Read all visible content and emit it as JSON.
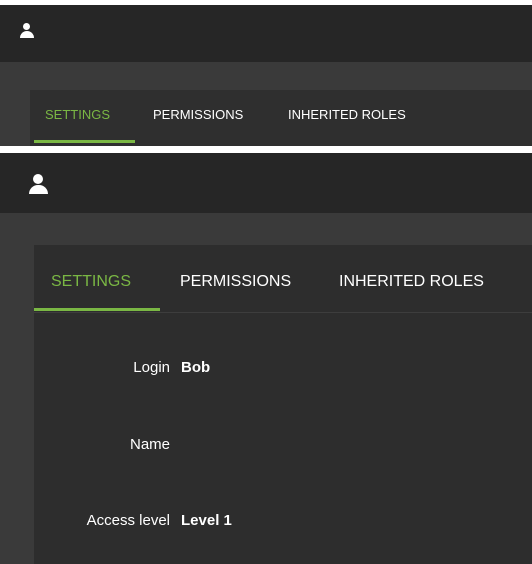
{
  "panel_small": {
    "tabs": [
      {
        "label": "SETTINGS",
        "active": true
      },
      {
        "label": "PERMISSIONS",
        "active": false
      },
      {
        "label": "INHERITED ROLES",
        "active": false
      }
    ]
  },
  "panel_large": {
    "tabs": [
      {
        "label": "SETTINGS",
        "active": true
      },
      {
        "label": "PERMISSIONS",
        "active": false
      },
      {
        "label": "INHERITED ROLES",
        "active": false
      }
    ],
    "fields": [
      {
        "label": "Login",
        "value": "Bob"
      },
      {
        "label": "Name",
        "value": ""
      },
      {
        "label": "Access level",
        "value": "Level 1"
      }
    ]
  },
  "colors": {
    "accent": "#7ab744",
    "title_bar": "#262626",
    "background": "#3a3a3a",
    "card": "#2d2d2d",
    "text": "#ffffff"
  },
  "icons": {
    "user": "user-icon"
  }
}
